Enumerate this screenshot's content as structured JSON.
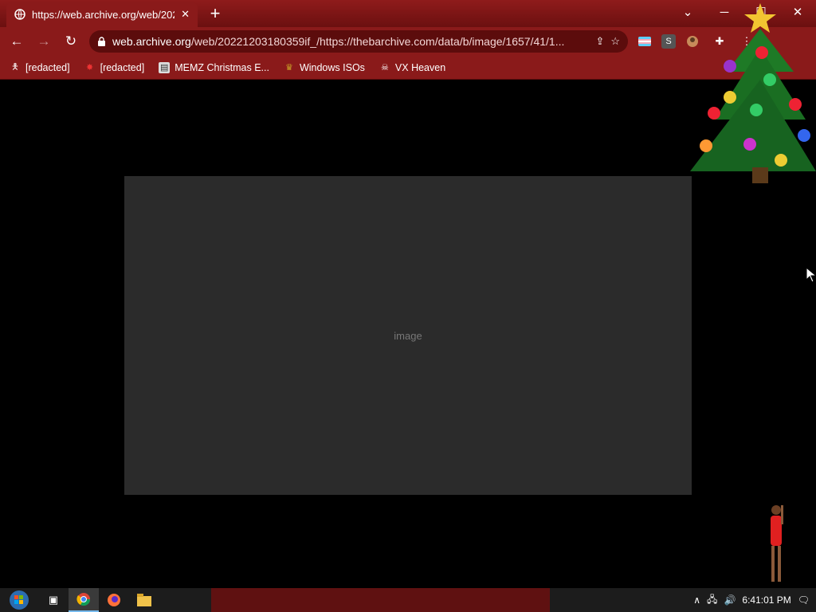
{
  "tab": {
    "title": "https://web.archive.org/web/202"
  },
  "toolbar": {
    "url_host": "web.archive.org",
    "url_rest": "/web/20221203180359if_/https://thebarchive.com/data/b/image/1657/41/1..."
  },
  "bookmarks": [
    {
      "label": "[redacted]",
      "icon": "figure-icon"
    },
    {
      "label": "[redacted]",
      "icon": "red-star-icon"
    },
    {
      "label": "MEMZ Christmas E...",
      "icon": "page-icon"
    },
    {
      "label": "Windows ISOs",
      "icon": "trophy-icon"
    },
    {
      "label": "VX Heaven",
      "icon": "skull-icon"
    }
  ],
  "content": {
    "image_placeholder": "image"
  },
  "taskbar": {
    "clock": "6:41:01 PM"
  },
  "colors": {
    "chrome_red": "#8a1a1a",
    "omnibox": "#5c0c0c",
    "page_bg": "#000000"
  }
}
